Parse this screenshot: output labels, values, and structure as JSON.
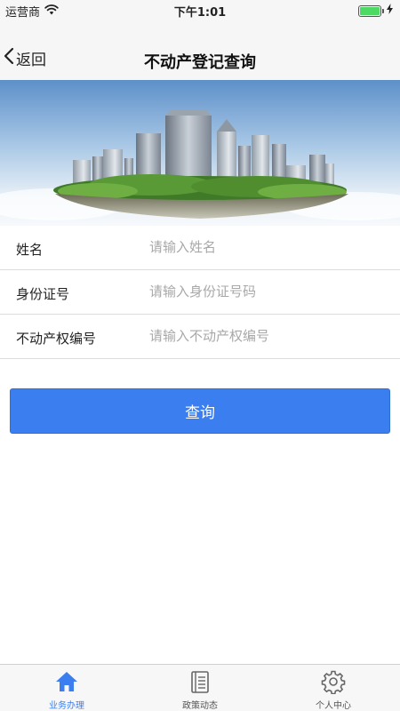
{
  "status_bar": {
    "carrier": "运营商",
    "time": "下午1:01",
    "wifi_icon": "wifi-icon",
    "battery_icon": "battery-icon",
    "charging_icon": "bolt-icon"
  },
  "nav": {
    "back_label": "返回",
    "back_icon": "chevron-left-icon",
    "title": "不动产登记查询"
  },
  "banner": {
    "image": "city-skyline-island-illustration"
  },
  "form": {
    "fields": [
      {
        "label": "姓名",
        "placeholder": "请输入姓名",
        "value": ""
      },
      {
        "label": "身份证号",
        "placeholder": "请输入身份证号码",
        "value": ""
      },
      {
        "label": "不动产权编号",
        "placeholder": "请输入不动产权编号",
        "value": ""
      }
    ]
  },
  "query_button": {
    "label": "查询"
  },
  "tab_bar": {
    "tabs": [
      {
        "label": "业务办理",
        "icon": "home-icon",
        "active": true
      },
      {
        "label": "政策动态",
        "icon": "document-icon",
        "active": false
      },
      {
        "label": "个人中心",
        "icon": "gear-icon",
        "active": false
      }
    ]
  },
  "colors": {
    "accent": "#3a7ef0",
    "nav_background": "#f6f6f6",
    "battery_green": "#4cd964"
  }
}
